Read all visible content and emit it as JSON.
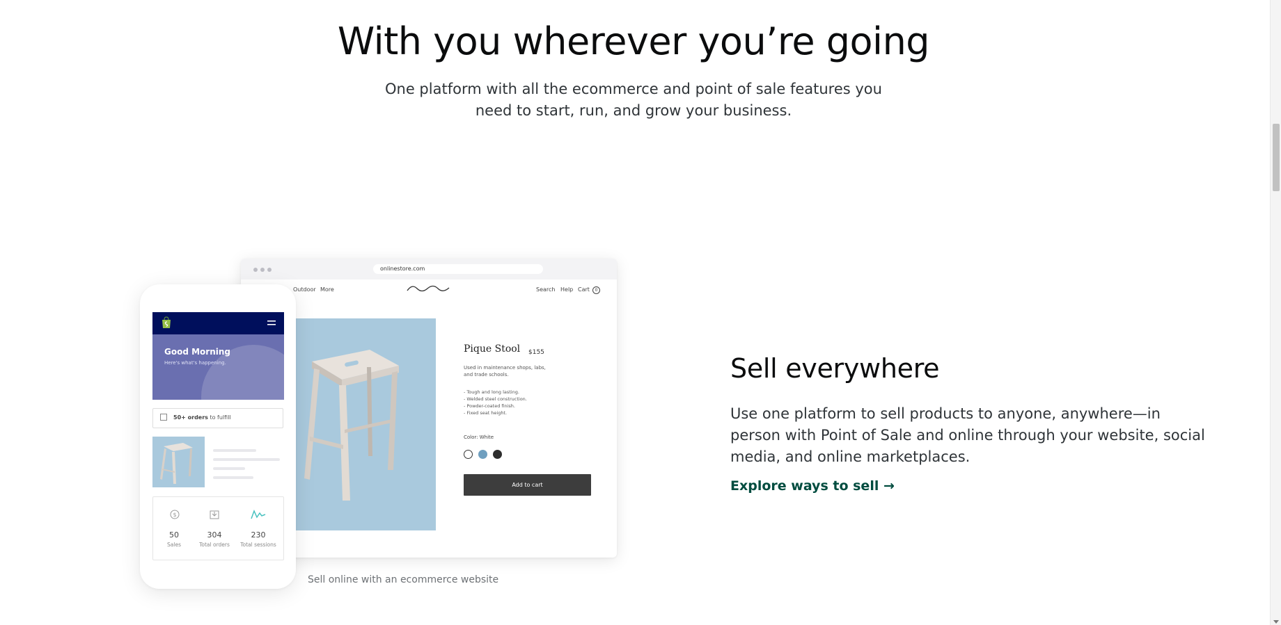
{
  "hero": {
    "title": "With you wherever you’re going",
    "subtitle": "One platform with all the ecommerce and point of sale features you need to start, run, and grow your business."
  },
  "browser_mock": {
    "url": "onlinestore.com",
    "nav_left": [
      "Outdoor",
      "More"
    ],
    "nav_right": [
      "Search",
      "Help",
      "Cart"
    ],
    "cart_count": "0",
    "product": {
      "name": "Pique Stool",
      "price": "$155",
      "description": "Used in maintenance shops, labs, and trade schools.",
      "bullets": [
        "- Tough and long lasting.",
        "- Welded steel construction.",
        "- Powder-coated finish.",
        "- Fixed seat height."
      ],
      "color_label": "Color: White",
      "swatches": [
        "#ffffff",
        "#6f9fbf",
        "#2d2d2d"
      ],
      "add_to_cart": "Add to cart"
    }
  },
  "phone_mock": {
    "greeting": "Good Morning",
    "greeting_sub": "Here's what's happening.",
    "orders_count": "50+ orders",
    "orders_suffix": " to fulfill",
    "stats": [
      {
        "value": "50",
        "label": "Sales",
        "icon": "dollar-icon"
      },
      {
        "value": "304",
        "label": "Total orders",
        "icon": "orders-icon"
      },
      {
        "value": "230",
        "label": "Total sessions",
        "icon": "sessions-icon"
      }
    ]
  },
  "caption": "Sell online with an ecommerce website",
  "section": {
    "title": "Sell everywhere",
    "body": "Use one platform to sell products to anyone, anywhere—in person with Point of Sale and online through your website, social media, and online marketplaces.",
    "link": "Explore ways to sell →"
  },
  "colors": {
    "link_green": "#004c3f",
    "phone_header_navy": "#000f5c",
    "accent_teal": "#47c1bf"
  }
}
